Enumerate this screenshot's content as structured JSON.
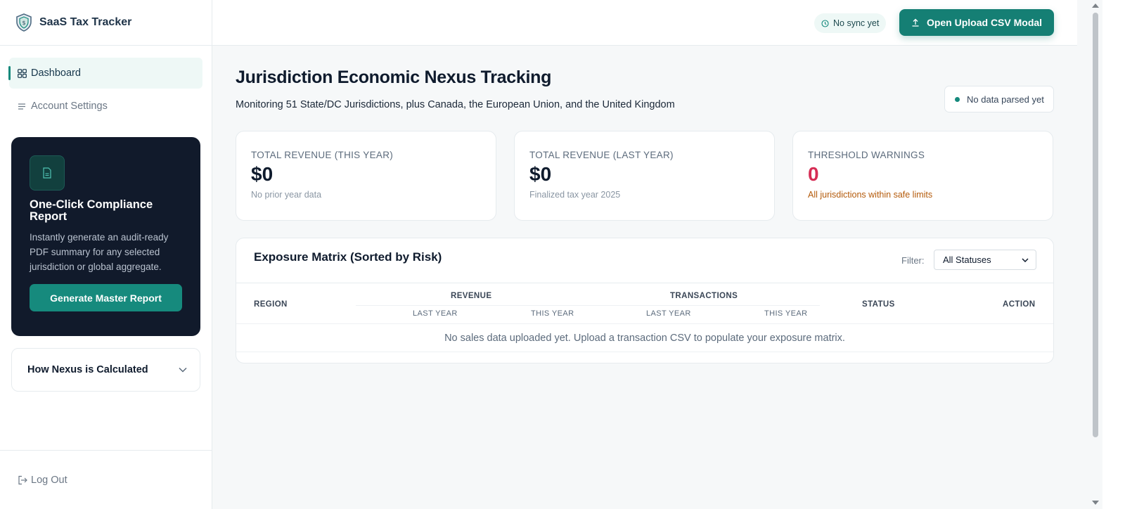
{
  "brand": {
    "name": "SaaS Tax Tracker"
  },
  "sidebar": {
    "nav": [
      {
        "label": "Dashboard",
        "icon": "grid-icon",
        "active": true
      },
      {
        "label": "Account Settings",
        "icon": "list-icon",
        "active": false
      }
    ],
    "promo": {
      "title": "One-Click Compliance Report",
      "description": "Instantly generate an audit-ready PDF summary for any selected jurisdiction or global aggregate.",
      "button_label": "Generate Master Report"
    },
    "accordion": {
      "label": "How Nexus is Calculated"
    },
    "logout_label": "Log Out"
  },
  "topbar": {
    "sync_status": "No sync yet",
    "upload_button": "Open Upload CSV Modal"
  },
  "main": {
    "title": "Jurisdiction Economic Nexus Tracking",
    "subtitle": "Monitoring 51 State/DC Jurisdictions, plus Canada, the European Union, and the United Kingdom",
    "parse_status": "No data parsed yet",
    "cards": [
      {
        "label": "TOTAL REVENUE (THIS YEAR)",
        "value": "$0",
        "note": "No prior year data"
      },
      {
        "label": "TOTAL REVENUE (LAST YEAR)",
        "value": "$0",
        "note": "Finalized tax year 2025"
      },
      {
        "label": "THRESHOLD WARNINGS",
        "value": "0",
        "note": "All jurisdictions within safe limits"
      }
    ],
    "matrix": {
      "title": "Exposure Matrix (Sorted by Risk)",
      "filter_label": "Filter:",
      "filter_value": "All Statuses",
      "columns": {
        "region": "REGION",
        "revenue": "REVENUE",
        "transactions": "TRANSACTIONS",
        "last_year": "LAST YEAR",
        "this_year": "THIS YEAR",
        "status": "STATUS",
        "action": "ACTION"
      },
      "empty_message": "No sales data uploaded yet. Upload a transaction CSV to populate your exposure matrix."
    }
  },
  "colors": {
    "accent": "#157f74",
    "sidebar_promo_bg": "#111a2b",
    "warning_red": "#d62d55",
    "warning_amber": "#b45a0a"
  }
}
